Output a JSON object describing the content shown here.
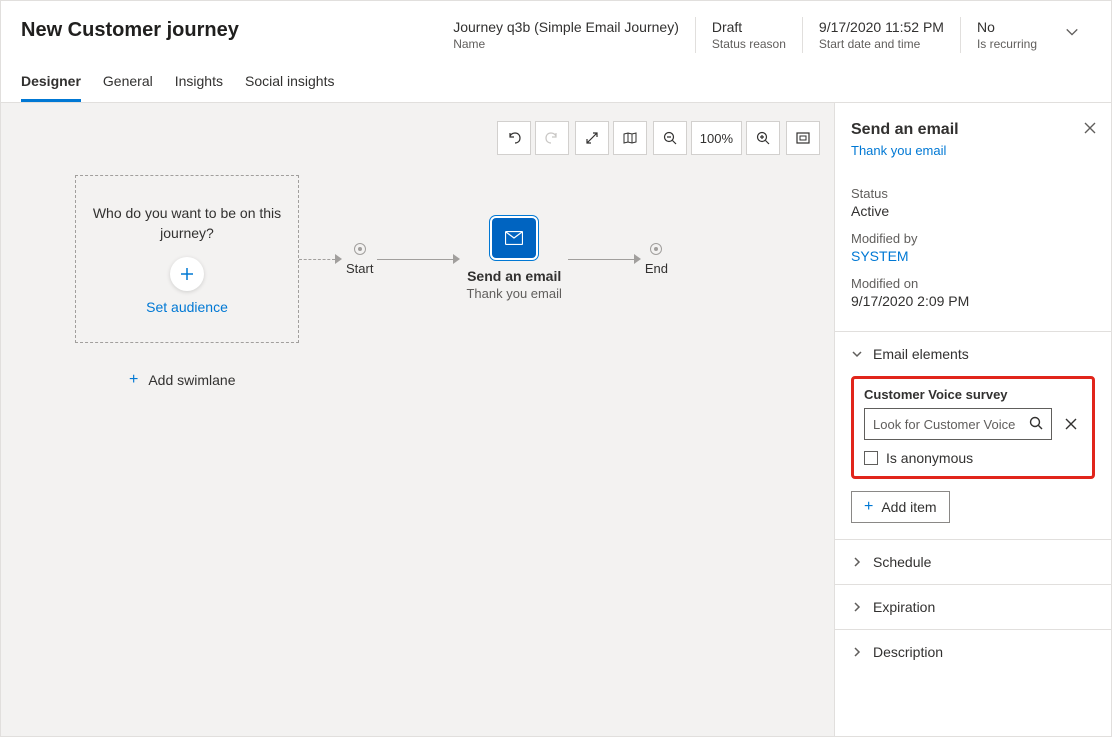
{
  "header": {
    "title": "New Customer journey",
    "meta": [
      {
        "value": "Journey q3b (Simple Email Journey)",
        "label": "Name"
      },
      {
        "value": "Draft",
        "label": "Status reason"
      },
      {
        "value": "9/17/2020 11:52 PM",
        "label": "Start date and time"
      },
      {
        "value": "No",
        "label": "Is recurring"
      }
    ]
  },
  "tabs": [
    "Designer",
    "General",
    "Insights",
    "Social insights"
  ],
  "canvas": {
    "zoom": "100%",
    "audience": {
      "question": "Who do you want to be on this journey?",
      "link": "Set audience"
    },
    "startLabel": "Start",
    "endLabel": "End",
    "emailNode": {
      "title": "Send an email",
      "subtitle": "Thank you email"
    },
    "addSwimlane": "Add swimlane"
  },
  "panel": {
    "title": "Send an email",
    "link": "Thank you email",
    "status": {
      "label": "Status",
      "value": "Active"
    },
    "modifiedBy": {
      "label": "Modified by",
      "value": "SYSTEM"
    },
    "modifiedOn": {
      "label": "Modified on",
      "value": "9/17/2020 2:09 PM"
    },
    "sections": {
      "emailElements": {
        "title": "Email elements",
        "survey": {
          "label": "Customer Voice survey",
          "placeholder": "Look for Customer Voice survey",
          "anonymous": "Is anonymous"
        },
        "addItem": "Add item"
      },
      "schedule": "Schedule",
      "expiration": "Expiration",
      "description": "Description"
    }
  }
}
